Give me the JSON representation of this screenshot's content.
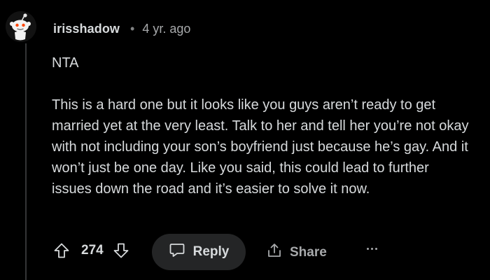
{
  "comment": {
    "username": "irisshadow",
    "separator": "•",
    "timestamp": "4 yr. ago",
    "body": [
      "NTA",
      "This is a hard one but it looks like you guys aren’t ready to get married yet at the very least. Talk to her and tell her you’re not okay with not including your son’s boyfriend just because he’s gay. And it won’t just be one day. Like you said, this could lead to further issues down the road and it’s easier to solve it now."
    ]
  },
  "actions": {
    "upvote_icon": "upvote-arrow-icon",
    "score": "274",
    "downvote_icon": "downvote-arrow-icon",
    "reply_icon": "speech-bubble-icon",
    "reply_label": "Reply",
    "share_icon": "share-upload-icon",
    "share_label": "Share",
    "more_icon": "ellipsis-icon"
  },
  "colors": {
    "background": "#000000",
    "text": "#d7dadc",
    "muted": "#a7a9ab",
    "reply_bg": "#242526",
    "thread_line": "#343536",
    "avatar_accent": "#ff4500"
  }
}
